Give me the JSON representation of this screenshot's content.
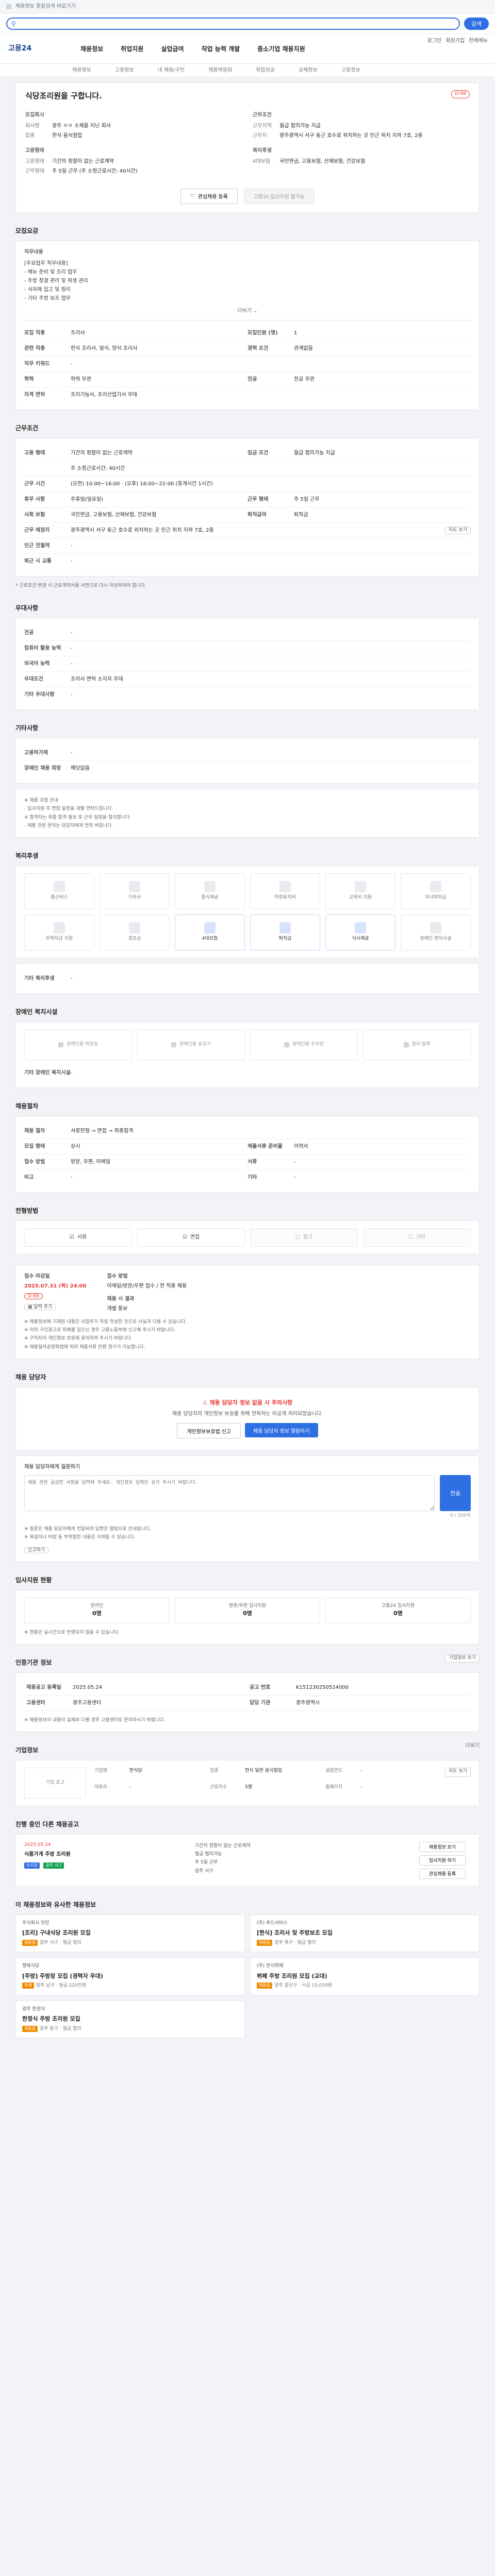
{
  "topbar": {
    "notice": "채용정보 통합검색 바로가기",
    "links": [
      "로그인",
      "회원가입"
    ]
  },
  "search": {
    "placeholder": "",
    "button": "검색"
  },
  "header": {
    "logo": "고용24",
    "links": [
      "로그인",
      "회원가입",
      "전체메뉴"
    ],
    "gnb": [
      "채용정보",
      "취업지원",
      "실업급여",
      "직업 능력 개발",
      "중소기업 채용지원"
    ],
    "lnb": [
      "채용정보",
      "고용정보",
      "내 채용/구인",
      "채용박람회",
      "취업성공",
      "공채정보",
      "고용정보"
    ]
  },
  "job": {
    "title": "식당조리원을 구합니다.",
    "dday": "D-68",
    "company_label": "모집회사",
    "company_rows": [
      {
        "k": "회사명",
        "v": "광주 ㅇㅇ 소재을 지닌 회사"
      },
      {
        "k": "업종",
        "v": "한식 음식점업"
      }
    ],
    "condition_label": "근무조건",
    "condition_rows": [
      {
        "k": "근무지역",
        "v": "월급 협의가능 지급"
      },
      {
        "k": "근무지",
        "v": "광주광역시 서구 둥근 호수로 위치하는 곳 인근 위치 지하 7호, 2층"
      }
    ],
    "hiring_label": "고용형태",
    "hiring_rows": [
      {
        "k": "고용형태",
        "v": "기간의 정함이 없는 근로계약"
      },
      {
        "k": "근무형태",
        "v": "주 5일 근무 (주 소정근로시간: 40시간)"
      }
    ],
    "welfare_label": "복리후생",
    "welfare_rows": [
      {
        "k": "4대보험",
        "v": "국민연금, 고용보험, 산재보험, 건강보험"
      }
    ],
    "scrap_btn": "관심채용 등록",
    "apply_btn": "고용24 입사지원 불가능"
  },
  "recruit": {
    "title": "모집요강",
    "duty_label": "직무내용",
    "duty_text": [
      "[주요업무 직무내용]",
      "- 메뉴 준비 및 조리 업무",
      "- 주방 청결 관리 및 위생 관리",
      "- 식자재 입고 및 정리",
      "- 기타 주방 보조 업무"
    ],
    "more": "더보기",
    "rows": [
      {
        "k": "모집 직종",
        "v": "조리사",
        "k2": "모집인원 (명)",
        "v2": "1"
      },
      {
        "k": "관련 직종",
        "v": "한식 조리사, 일식, 양식 조리사",
        "k2": "경력 조건",
        "v2": "관계없음"
      },
      {
        "k": "직무 키워드",
        "v": "-"
      },
      {
        "k": "학력",
        "v": "학력 무관",
        "k2": "전공",
        "v2": "전공 무관"
      },
      {
        "k": "자격 면허",
        "v": "조리기능사, 조리산업기사 우대"
      }
    ]
  },
  "work": {
    "title": "근무조건",
    "rows": [
      {
        "k": "고용 형태",
        "v": "기간의 정함이 없는 근로계약",
        "k2": "임금 조건",
        "v2": "월급 협의가능 지급"
      },
      {
        "k": "",
        "v": "주 소정근로시간: 40시간"
      },
      {
        "k": "근무 시간",
        "v": "(오전) 10:00~16:00 · (오후) 16:00~22:00 (휴게시간 1시간)"
      },
      {
        "k": "휴무 사항",
        "v": "주휴일(일요일)",
        "k2": "근무 형태",
        "v2": "주 5일 근무"
      },
      {
        "k": "사회 보험",
        "v": "국민연금, 고용보험, 산재보험, 건강보험",
        "k2": "퇴직급여",
        "v2": "퇴직금"
      },
      {
        "k": "근무 예정지",
        "v": "광주광역시 서구 둥근 호수로 위치하는 곳 인근 위치 지하 7호, 2층",
        "k2": "",
        "v2": "지도 보기"
      },
      {
        "k": "인근 전철역",
        "v": "-"
      },
      {
        "k": "퇴근 시 교통",
        "v": "-"
      }
    ],
    "note": "* 근로조건 변경 시 근로계약서를 서면으로 다시 작성하여야 합니다."
  },
  "preference": {
    "title": "우대사항",
    "rows": [
      {
        "k": "전공",
        "v": "-"
      },
      {
        "k": "컴퓨터 활용 능력",
        "v": "-"
      },
      {
        "k": "외국어 능력",
        "v": "-"
      },
      {
        "k": "우대조건",
        "v": "조리사 면허 소지자 우대"
      },
      {
        "k": "기타 우대사항",
        "v": "-"
      }
    ]
  },
  "etc": {
    "title": "기타사항",
    "rows": [
      {
        "k": "고용허가제",
        "v": "-"
      },
      {
        "k": "장애인 채용 희망",
        "v": "해당없음"
      }
    ],
    "notes": [
      "※ 채용 과정 안내",
      "- 입사지원 후 면접 일정을 개별 연락드립니다.",
      "※ 합격자는 최종 합격 통보 후 근무 일정을 협의합니다.",
      "- 채용 관련 문의는 담당자에게 연락 바랍니다."
    ]
  },
  "welfare": {
    "title": "복리후생",
    "items": [
      {
        "name": "통근버스",
        "on": false
      },
      {
        "name": "기숙사",
        "on": false
      },
      {
        "name": "중식제공",
        "on": false
      },
      {
        "name": "차량유지비",
        "on": false
      },
      {
        "name": "교육비 지원",
        "on": false
      },
      {
        "name": "자녀학자금",
        "on": false
      },
      {
        "name": "주택자금 지원",
        "on": false
      },
      {
        "name": "경조금",
        "on": false
      },
      {
        "name": "4대보험",
        "on": true
      },
      {
        "name": "퇴직금",
        "on": true
      },
      {
        "name": "식사제공",
        "on": true
      },
      {
        "name": "장애인 편의시설",
        "on": false
      }
    ],
    "etc_label": "기타 복리후생",
    "etc_value": "-"
  },
  "disability": {
    "title": "장애인 복지시설",
    "items": [
      "장애인용 화장실",
      "장애인용 승강기",
      "장애인용 주차장",
      "점자 블록"
    ],
    "etc_label": "기타 장애인 복지시설",
    "etc_value": "-"
  },
  "process": {
    "title": "채용절차",
    "rows": [
      {
        "k": "채용 절차",
        "v": "서류전형 → 면접 → 최종합격"
      },
      {
        "k": "모집 형태",
        "v": "상시",
        "k2": "제출서류 준비물",
        "v2": "이력서"
      },
      {
        "k": "접수 방법",
        "v": "방문, 우편, 이메일",
        "k2": "서류",
        "v2": "-"
      },
      {
        "k": "비고",
        "v": "-",
        "k2": "기타",
        "v2": "-"
      }
    ]
  },
  "method": {
    "title": "전형방법",
    "items": [
      {
        "name": "서류",
        "on": true
      },
      {
        "name": "면접",
        "on": true
      },
      {
        "name": "필기",
        "on": false
      },
      {
        "name": "기타",
        "on": false
      }
    ]
  },
  "period": {
    "label_deadline": "접수 마감일",
    "deadline": "2025.07.31 (목) 24:00",
    "dday": "D-68",
    "calendar_btn": "달력 추가",
    "label_method": "접수 방법",
    "method": "이메일/방문/우편 접수 / 전 직종 채용",
    "label_result": "채용 시 결과",
    "result": "개별 통보",
    "notes": [
      "※ 채용정보에 기재된 내용은 사업주가 직접 작성한 것으로 사실과 다를 수 있습니다.",
      "※ 허위 구인광고로 피해를 입으신 경우 고용노동부에 신고해 주시기 바랍니다.",
      "※ 구직자의 개인정보 보호에 유의하여 주시기 바랍니다.",
      "※ 채용절차공정화법에 따라 채용서류 반환 청구가 가능합니다."
    ]
  },
  "contact": {
    "title": "채용 담당자",
    "alert": "채용 담당자 정보 없음 시 주의사항",
    "desc": "채용 담당자의 개인정보 보호를 위해 연락처는 비공개 처리되었습니다.",
    "btn_report": "개인정보보호법 신고",
    "btn_contact": "채용 담당자 정보 열람하기",
    "qa_label": "채용 담당자에게 질문하기",
    "qa_placeholder": "채용 관련 궁금한 사항을 입력해 주세요. 개인정보 입력은 삼가 주시기 바랍니다.",
    "qa_count": "0 / 500자",
    "qa_submit": "전송",
    "notes": [
      "※ 질문은 채용 담당자에게 전달되며 답변은 알림으로 안내됩니다.",
      "※ 욕설이나 비방 등 부적절한 내용은 삭제될 수 있습니다."
    ],
    "report_btn": "신고하기"
  },
  "apply_status": {
    "title": "입사지원 현황",
    "items": [
      {
        "name": "온라인",
        "value": "0명"
      },
      {
        "name": "방문/우편 입사지원",
        "value": "0명"
      },
      {
        "name": "고용24 입사지원",
        "value": "0명"
      }
    ],
    "note": "※ 현황은 실시간으로 반영되지 않을 수 있습니다."
  },
  "info": {
    "title": "인증기관 정보",
    "btn": "기업정보 보기",
    "rows": [
      {
        "k": "채용공고 등록일",
        "v": "2025.05.24",
        "k2": "공고 번호",
        "v2": "K151230250524000"
      },
      {
        "k": "고용센터",
        "v": "광주고용센터",
        "k2": "담당 기관",
        "v2": "광주광역시"
      }
    ],
    "note": "※ 채용정보의 내용이 실제와 다를 경우 고용센터로 문의하시기 바랍니다."
  },
  "company": {
    "title": "기업정보",
    "more": "더보기",
    "logo": "기업 로고",
    "rows": [
      {
        "k": "기업명",
        "v": "한식당"
      },
      {
        "k": "업종",
        "v": "한식 일반 음식점업"
      },
      {
        "k": "설립연도",
        "v": "-"
      },
      {
        "k": "대표자",
        "v": "-"
      },
      {
        "k": "근로자수",
        "v": "5명"
      },
      {
        "k": "홈페이지",
        "v": "-"
      }
    ],
    "map_btn": "지도 보기"
  },
  "recent": {
    "title": "진행 중인 다른 채용공고",
    "date": "2025.05.24",
    "job": "식품가게 주방 조리원",
    "tags": [
      "조리원",
      "광주 서구"
    ],
    "items": [
      "기간의 정함이 없는 근로계약",
      "월급 협의가능",
      "주 5일 근무",
      "광주 서구"
    ],
    "buttons": [
      "채용정보 보기",
      "입사지원 하기",
      "관심채용 등록"
    ]
  },
  "similar": {
    "title": "이 채용정보와 유사한 채용정보",
    "items": [
      {
        "co": "주식회사 맛찬",
        "title": "[조리] 구내식당 조리원 모집",
        "meta": "광주 서구 · 월급 협의",
        "tag": "채용중"
      },
      {
        "co": "(주) 푸드서비스",
        "title": "[한식] 조리사 및 주방보조 모집",
        "meta": "광주 북구 · 월급 협의",
        "tag": "채용중"
      },
      {
        "co": "행복식당",
        "title": "[주방] 주방장 모집 (경력자 우대)",
        "meta": "광주 남구 · 월급 220만원",
        "tag": "우대"
      },
      {
        "co": "(주) 한식뷔페",
        "title": "뷔페 주방 조리원 모집 (교대)",
        "meta": "광주 광산구 · 시급 10,030원",
        "tag": "채용중"
      },
      {
        "co": "광주 한정식",
        "title": "한정식 주방 조리원 모집",
        "meta": "광주 동구 · 월급 협의",
        "tag": "채용중"
      }
    ]
  }
}
